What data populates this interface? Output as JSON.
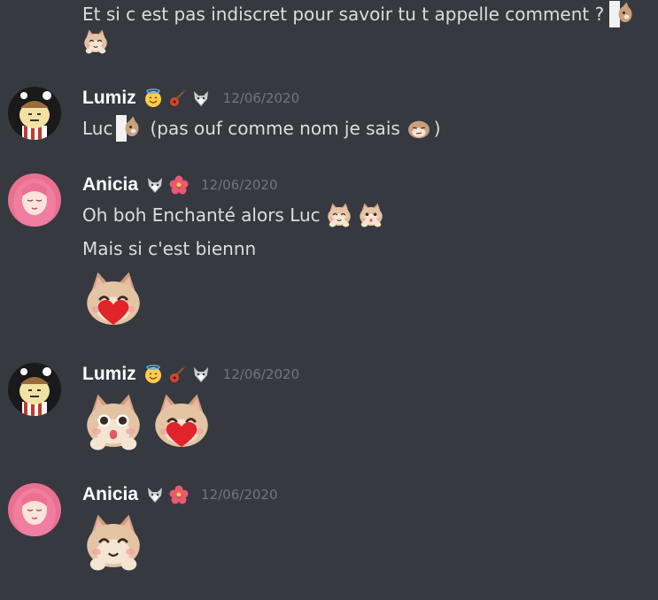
{
  "messages": {
    "m0": {
      "line1": "Et si c est pas indiscret pour savoir tu t appelle comment ?"
    },
    "m1": {
      "username": "Lumiz",
      "timestamp": "12/06/2020",
      "text_a": "Luc",
      "text_b": "(pas ouf comme nom je sais",
      "text_c": ")",
      "badges": [
        "angel-face-emoji",
        "guitar-emoji",
        "wolf-emoji"
      ]
    },
    "m2": {
      "username": "Anicia",
      "timestamp": "12/06/2020",
      "line1": "Oh boh Enchanté alors Luc",
      "line2": "Mais si c'est biennn",
      "badges": [
        "wolf-emoji",
        "hibiscus-emoji"
      ]
    },
    "m3": {
      "username": "Lumiz",
      "timestamp": "12/06/2020",
      "badges": [
        "angel-face-emoji",
        "guitar-emoji",
        "wolf-emoji"
      ]
    },
    "m4": {
      "username": "Anicia",
      "timestamp": "12/06/2020",
      "badges": [
        "wolf-emoji",
        "hibiscus-emoji"
      ]
    }
  },
  "colors": {
    "background": "#36393f",
    "username": "#ffffff",
    "text": "#dcddde",
    "timestamp": "#72767d"
  }
}
